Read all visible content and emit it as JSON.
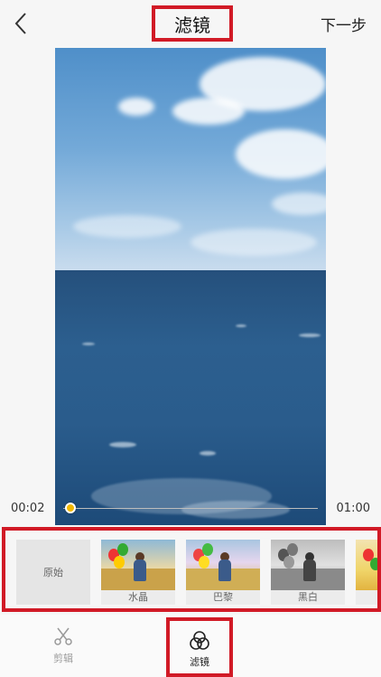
{
  "header": {
    "title": "滤镜",
    "next_label": "下一步"
  },
  "player": {
    "current_time": "00:02",
    "duration": "01:00",
    "progress_fraction": 0.03
  },
  "filters": {
    "items": [
      {
        "label": "原始"
      },
      {
        "label": "水晶"
      },
      {
        "label": "巴黎"
      },
      {
        "label": "黑白"
      },
      {
        "label": ""
      }
    ]
  },
  "bottom_tabs": {
    "edit_label": "剪辑",
    "filter_label": "滤镜"
  },
  "colors": {
    "highlight": "#d11a26",
    "scrub_knob": "#f2b800"
  }
}
